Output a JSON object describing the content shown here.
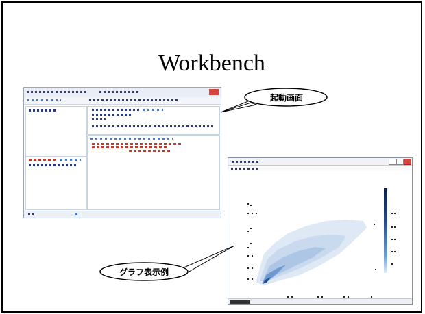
{
  "slide": {
    "title": "Workbench"
  },
  "callouts": {
    "startup": "起動画面",
    "graph_example": "グラフ表示例"
  }
}
